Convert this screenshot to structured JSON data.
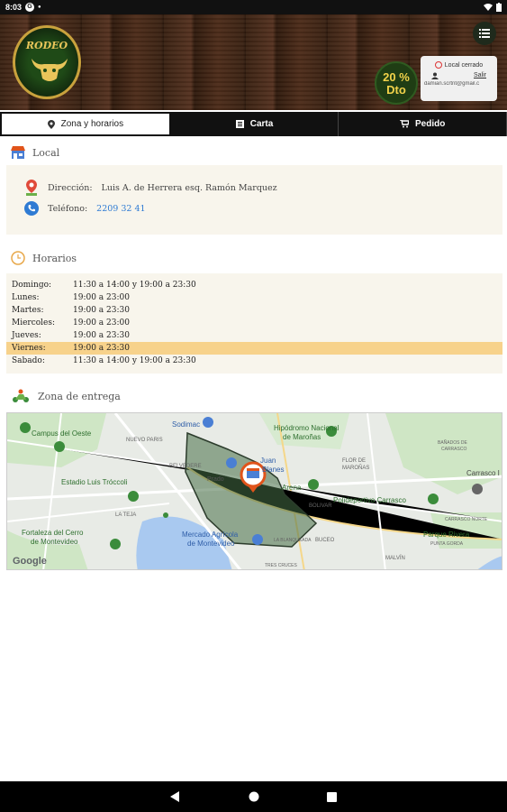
{
  "status_bar": {
    "time": "8:03",
    "g_icon": "G"
  },
  "header": {
    "logo_text": "RODEO",
    "discount_line1": "20 %",
    "discount_line2": "Dto",
    "store_status": "Local cerrado",
    "logout_label": "Salir",
    "user_email": "damian.scrtnt@gmail.c"
  },
  "tabs": [
    {
      "label": "Zona y horarios",
      "icon": "map-pin-icon"
    },
    {
      "label": "Carta",
      "icon": "menu-book-icon"
    },
    {
      "label": "Pedido",
      "icon": "cart-icon"
    }
  ],
  "local": {
    "title": "Local",
    "address_label": "Dirección:",
    "address_value": "Luis A. de Herrera esq. Ramón Marquez",
    "phone_label": "Teléfono:",
    "phone_value": "2209 32 41"
  },
  "horarios": {
    "title": "Horarios",
    "rows": [
      {
        "day": "Domingo:",
        "hours": "11:30 a 14:00 y 19:00 a 23:30"
      },
      {
        "day": "Lunes:",
        "hours": "19:00 a 23:00"
      },
      {
        "day": "Martes:",
        "hours": "19:00 a 23:30"
      },
      {
        "day": "Miercoles:",
        "hours": "19:00 a 23:00"
      },
      {
        "day": "Jueves:",
        "hours": "19:00 a 23:30"
      },
      {
        "day": "Viernes:",
        "hours": "19:00 a 23:30"
      },
      {
        "day": "Sabado:",
        "hours": "11:30 a 14:00 y 19:00 a 23:30"
      }
    ],
    "highlighted_day": "Viernes:"
  },
  "zona": {
    "title": "Zona de entrega",
    "map_labels": {
      "campus": "Campus del Oeste",
      "sodimac": "Sodimac",
      "hipodromo_1": "Hipódromo Nacional",
      "hipodromo_2": "de Maroñas",
      "estadio": "Estadio Luis Tróccoli",
      "juan_blanes_1": "Juan",
      "juan_blanes_2": "Blanes",
      "arena": "Arena",
      "polideportivo": "Polideportivo Carrasco",
      "carrasco": "Carrasco I",
      "fortaleza_1": "Fortaleza del Cerro",
      "fortaleza_2": "de Montevideo",
      "mercado_1": "Mercado Agrícola",
      "mercado_2": "de Montevideo",
      "parque_rivera": "Parque Rivera",
      "nuevo_paris": "NUEVO PARIS",
      "belvedere": "BELVEDERE",
      "prado": "Prado",
      "flor_maronas_1": "FLOR DE",
      "flor_maronas_2": "MAROÑAS",
      "bañados": "BAÑADOS DE",
      "bañados2": "CARRASCO",
      "bolivar": "BOLIVAR",
      "buceo": "BUCEO",
      "carrasco_norte": "CARRASCO NORTE",
      "punta_gorda": "PUNTA GORDA",
      "malvin": "MALVÍN",
      "tres_cruces": "TRES CRUCES",
      "la_teja": "LA TEJA",
      "blanqueada": "LA BLANQUEADA",
      "google": "Google"
    }
  },
  "colors": {
    "accent_orange": "#e0541b",
    "highlight_row": "#f7d28b",
    "panel_bg": "#f8f5ec",
    "phone_link": "#2f7bd3"
  }
}
